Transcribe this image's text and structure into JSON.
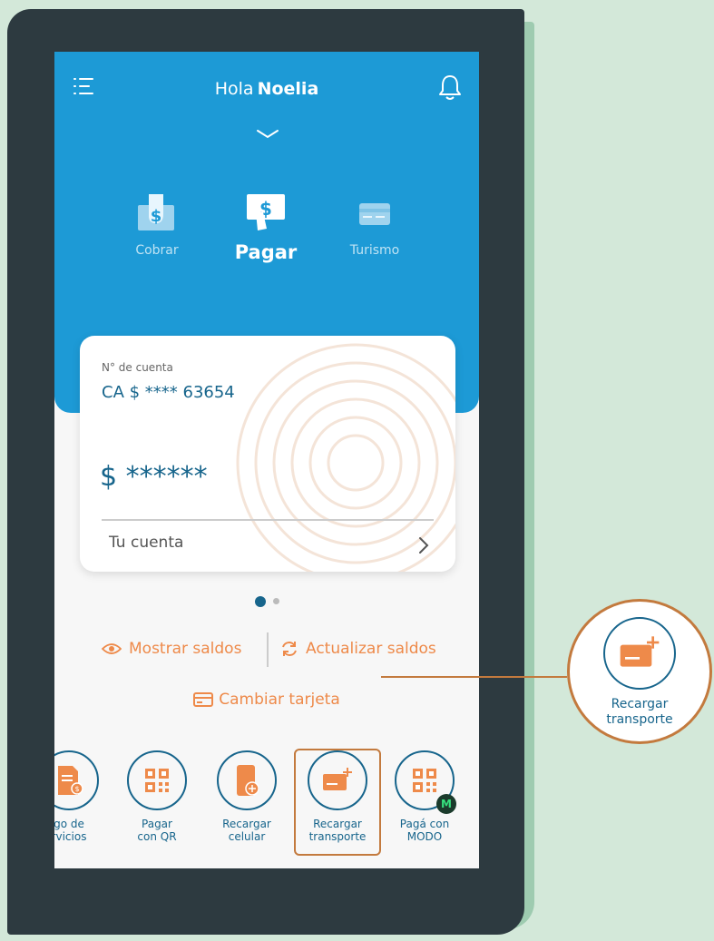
{
  "header": {
    "greeting": "Hola",
    "user_name": "Noelia"
  },
  "modes": [
    {
      "label": "Cobrar",
      "active": false
    },
    {
      "label": "Pagar",
      "active": true
    },
    {
      "label": "Turismo",
      "active": false
    }
  ],
  "account_card": {
    "account_label": "N° de cuenta",
    "account_number": "CA $ **** 63654",
    "balance": "$ ******",
    "link_label": "Tu cuenta"
  },
  "pager": {
    "pages": 2,
    "current": 1
  },
  "actions": {
    "show_balances": "Mostrar saldos",
    "refresh_balances": "Actualizar saldos",
    "change_card": "Cambiar tarjeta"
  },
  "shortcuts": [
    {
      "label": "go de\nrvicios",
      "icon": "bill-icon"
    },
    {
      "label": "Pagar\ncon QR",
      "icon": "qr-icon"
    },
    {
      "label": "Recargar\ncelular",
      "icon": "phone-topup-icon"
    },
    {
      "label": "Recargar\ntransporte",
      "icon": "transport-card-topup-icon",
      "highlighted": true
    },
    {
      "label": "Pagá con\nMODO",
      "icon": "qr-icon",
      "badge": "M"
    }
  ],
  "zoom_callout": {
    "label": "Recargar\ntransporte"
  },
  "colors": {
    "header_blue": "#1d9ad6",
    "text_blue": "#17658c",
    "accent_orange": "#ee8a4a",
    "highlight_border": "#c37a3e",
    "background_green": "#d3e8d9",
    "device_dark": "#2d3a40"
  }
}
